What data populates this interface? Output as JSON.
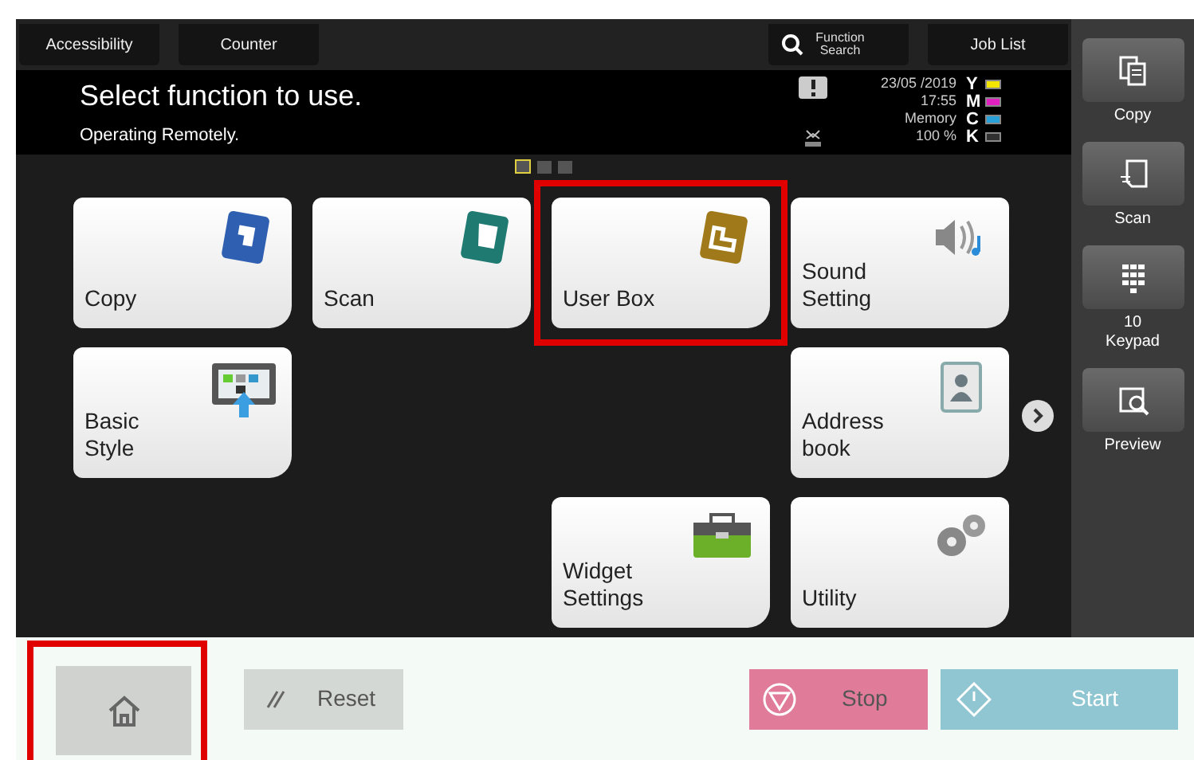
{
  "top_tabs": [
    {
      "label": "Accessibility",
      "kind": "tab"
    },
    {
      "label": "Counter",
      "kind": "tab"
    },
    {
      "label": "Function Search",
      "kind": "search"
    },
    {
      "label": "Job List",
      "kind": "tab"
    }
  ],
  "header": {
    "title": "Select function to use.",
    "subtitle": "Operating Remotely.",
    "date": "23/05 /2019",
    "time": "17:55",
    "memory_label": "Memory",
    "memory": "100 %",
    "toner": [
      {
        "letter": "Y",
        "color": "#f2e600"
      },
      {
        "letter": "M",
        "color": "#e020c0"
      },
      {
        "letter": "C",
        "color": "#2aa0d8"
      },
      {
        "letter": "K",
        "color": "#303030"
      }
    ]
  },
  "pages": [
    {
      "selected": true
    },
    {
      "selected": false
    },
    {
      "selected": false
    }
  ],
  "tiles": [
    {
      "label": "Copy",
      "highlighted": false
    },
    {
      "label": "Scan",
      "highlighted": false
    },
    {
      "label": "User Box",
      "highlighted": true
    },
    {
      "label": "Sound Setting",
      "highlighted": false
    },
    {
      "label": "Basic Style",
      "highlighted": false
    },
    {
      "label": "Address book",
      "highlighted": false
    },
    {
      "label": "Widget Settings",
      "highlighted": false
    },
    {
      "label": "Utility",
      "highlighted": false
    }
  ],
  "sidebar": [
    {
      "label": "Copy"
    },
    {
      "label": "Scan"
    },
    {
      "label": "10 Keypad"
    },
    {
      "label": "Preview"
    }
  ],
  "bottom": {
    "home": {
      "highlighted": true
    },
    "reset": "Reset",
    "stop": "Stop",
    "start": {
      "label": "Start",
      "disabled": true
    }
  }
}
